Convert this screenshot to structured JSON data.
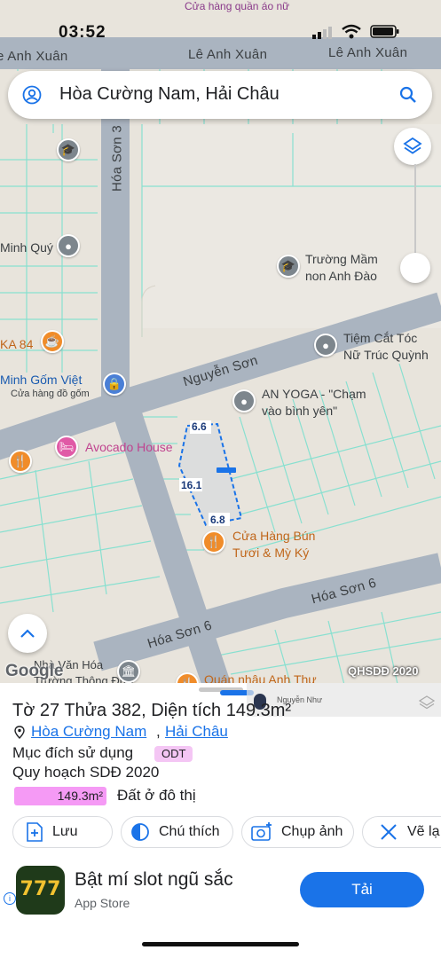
{
  "status_bar": {
    "time": "03:52"
  },
  "search": {
    "query": "Hòa Cường Nam, Hải Châu"
  },
  "map": {
    "streets": {
      "le_anh_xuan_left": "e Anh Xuân",
      "le_anh_xuan_mid": "Lê Anh Xuân",
      "le_anh_xuan_right": "Lê Anh Xuân",
      "hoa_son_3": "Hóa Sơn 3",
      "nguyen_son": "Nguyễn Sơn",
      "hoa_son_6_right": "Hóa Sơn 6",
      "hoa_son_6_left": "Hóa Sơn 6"
    },
    "places": {
      "top_shop": "Cửa hàng quần áo nữ",
      "minh_quy": "Minh Quý",
      "truong_mam_non_1": "Trường Mầm",
      "truong_mam_non_2": "non Anh Đào",
      "ka84": "KA 84",
      "tiem_cat_toc_1": "Tiệm Cắt Tóc",
      "tiem_cat_toc_2": "Nữ Trúc Quỳnh",
      "minh_gom_viet": "Minh Gốm Việt",
      "minh_gom_viet_sub": "Cửa hàng đồ gốm",
      "an_yoga_1": "AN YOGA - \"Chạm",
      "an_yoga_2": "vào bình yên\"",
      "avocado_house": "Avocado House",
      "bun_tuoi_1": "Cửa Hàng Bún",
      "bun_tuoi_2": "Tươi & Mỳ Ký",
      "nha_van_hoa_1": "Nhà Văn Hóa",
      "nha_van_hoa_2": "Trường Thông Đưa...",
      "quan_nhau": "Quán nhậu Anh Thư"
    },
    "parcel_dims": {
      "top": "6.6",
      "left": "16.1",
      "bottom": "6.8"
    },
    "google_logo": "Google",
    "map_badge": "QHSDĐ 2020",
    "owner_label": "Nguyễn Như"
  },
  "sheet": {
    "title": "Tờ 27 Thửa 382, Diện tích 149.3m²",
    "location_ward": "Hòa Cường Nam",
    "location_separator": ",",
    "location_district": "Hải Châu",
    "purpose_label": "Mục đích sử dụng",
    "purpose_badge": "ODT",
    "plan_label": "Quy hoạch SDĐ 2020",
    "plan_area": "149.3m²",
    "plan_desc": "Đất ở đô thị",
    "actions": {
      "save": "Lưu",
      "legend": "Chú thích",
      "capture": "Chụp ảnh",
      "draw": "Vẽ lạ"
    }
  },
  "ad": {
    "title": "Bật mí slot ngũ sắc",
    "source": "App Store",
    "icon_text": "777",
    "cta": "Tải"
  },
  "colors": {
    "road": "#aab4c0",
    "land": "#e8e4dc",
    "parcel_line": "#7ee0cf",
    "parcel_outline": "#1a73e8",
    "poi_orange": "#f08c2a",
    "poi_gray": "#7d868d",
    "poi_pink": "#e05aa6",
    "poi_blue": "#4a7fd6",
    "accent_blue": "#1a73e8",
    "badge_purple": "#f4c6f4",
    "area_pink": "#f59af5",
    "cta_blue": "#1a73e8"
  }
}
